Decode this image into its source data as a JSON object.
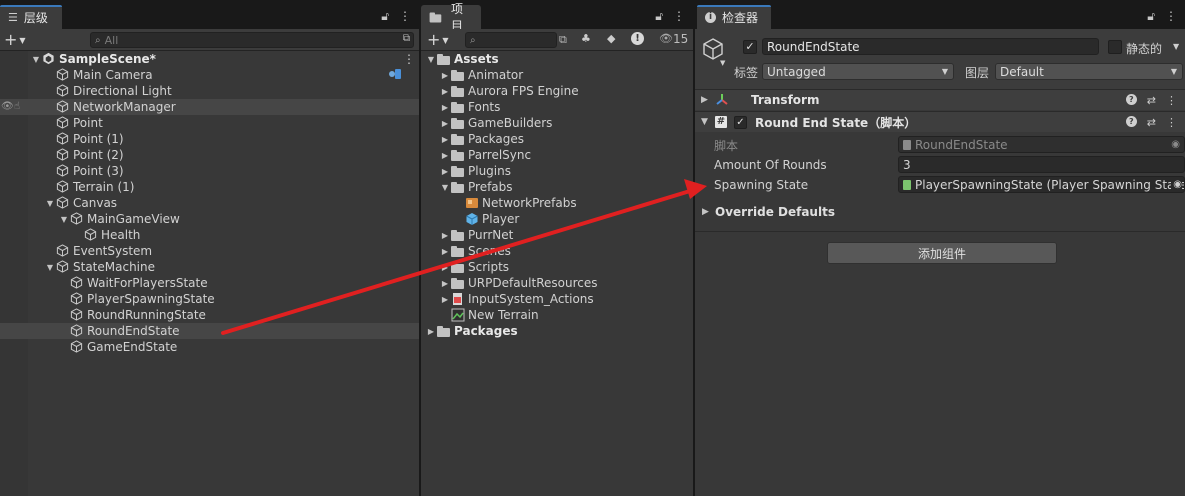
{
  "hierarchy": {
    "tab_label": "层级",
    "search_placeholder": "All",
    "rows": [
      {
        "label": "SampleScene*",
        "depth": 0,
        "arrow": "open",
        "icon": "unity-scene-icon",
        "bold": true,
        "highlighted": false
      },
      {
        "label": "Main Camera",
        "depth": 1,
        "arrow": "",
        "icon": "cube-icon",
        "bold": false,
        "highlighted": false
      },
      {
        "label": "Directional Light",
        "depth": 1,
        "arrow": "",
        "icon": "cube-icon",
        "bold": false,
        "highlighted": false
      },
      {
        "label": "NetworkManager",
        "depth": 1,
        "arrow": "",
        "icon": "cube-icon",
        "bold": false,
        "highlighted": true
      },
      {
        "label": "Point",
        "depth": 1,
        "arrow": "",
        "icon": "cube-icon",
        "bold": false,
        "highlighted": false
      },
      {
        "label": "Point (1)",
        "depth": 1,
        "arrow": "",
        "icon": "cube-icon",
        "bold": false,
        "highlighted": false
      },
      {
        "label": "Point (2)",
        "depth": 1,
        "arrow": "",
        "icon": "cube-icon",
        "bold": false,
        "highlighted": false
      },
      {
        "label": "Point (3)",
        "depth": 1,
        "arrow": "",
        "icon": "cube-icon",
        "bold": false,
        "highlighted": false
      },
      {
        "label": "Terrain (1)",
        "depth": 1,
        "arrow": "",
        "icon": "cube-icon",
        "bold": false,
        "highlighted": false
      },
      {
        "label": "Canvas",
        "depth": 1,
        "arrow": "open",
        "icon": "cube-icon",
        "bold": false,
        "highlighted": false
      },
      {
        "label": "MainGameView",
        "depth": 2,
        "arrow": "open",
        "icon": "cube-icon",
        "bold": false,
        "highlighted": false
      },
      {
        "label": "Health",
        "depth": 3,
        "arrow": "",
        "icon": "cube-icon",
        "bold": false,
        "highlighted": false
      },
      {
        "label": "EventSystem",
        "depth": 1,
        "arrow": "",
        "icon": "cube-icon",
        "bold": false,
        "highlighted": false
      },
      {
        "label": "StateMachine",
        "depth": 1,
        "arrow": "open",
        "icon": "cube-icon",
        "bold": false,
        "highlighted": false
      },
      {
        "label": "WaitForPlayersState",
        "depth": 2,
        "arrow": "",
        "icon": "cube-icon",
        "bold": false,
        "highlighted": false
      },
      {
        "label": "PlayerSpawningState",
        "depth": 2,
        "arrow": "",
        "icon": "cube-icon",
        "bold": false,
        "highlighted": false
      },
      {
        "label": "RoundRunningState",
        "depth": 2,
        "arrow": "",
        "icon": "cube-icon",
        "bold": false,
        "highlighted": false
      },
      {
        "label": "RoundEndState",
        "depth": 2,
        "arrow": "",
        "icon": "cube-icon",
        "bold": false,
        "highlighted": true
      },
      {
        "label": "GameEndState",
        "depth": 2,
        "arrow": "",
        "icon": "cube-icon",
        "bold": false,
        "highlighted": false
      }
    ]
  },
  "project": {
    "tab_label": "项目",
    "hidden_count": "15",
    "rows": [
      {
        "label": "Assets",
        "depth": 0,
        "arrow": "open",
        "icon": "folder-icon",
        "bold": true
      },
      {
        "label": "Animator",
        "depth": 1,
        "arrow": "closed",
        "icon": "folder-icon",
        "bold": false
      },
      {
        "label": "Aurora FPS Engine",
        "depth": 1,
        "arrow": "closed",
        "icon": "folder-icon",
        "bold": false
      },
      {
        "label": "Fonts",
        "depth": 1,
        "arrow": "closed",
        "icon": "folder-icon",
        "bold": false
      },
      {
        "label": "GameBuilders",
        "depth": 1,
        "arrow": "closed",
        "icon": "folder-icon",
        "bold": false
      },
      {
        "label": "Packages",
        "depth": 1,
        "arrow": "closed",
        "icon": "folder-icon",
        "bold": false
      },
      {
        "label": "ParrelSync",
        "depth": 1,
        "arrow": "closed",
        "icon": "folder-icon",
        "bold": false
      },
      {
        "label": "Plugins",
        "depth": 1,
        "arrow": "closed",
        "icon": "folder-icon",
        "bold": false
      },
      {
        "label": "Prefabs",
        "depth": 1,
        "arrow": "open",
        "icon": "folder-icon",
        "bold": false
      },
      {
        "label": "NetworkPrefabs",
        "depth": 2,
        "arrow": "",
        "icon": "network-prefabs-icon",
        "bold": false
      },
      {
        "label": "Player",
        "depth": 2,
        "arrow": "",
        "icon": "prefab-icon",
        "bold": false
      },
      {
        "label": "PurrNet",
        "depth": 1,
        "arrow": "closed",
        "icon": "folder-icon",
        "bold": false
      },
      {
        "label": "Scenes",
        "depth": 1,
        "arrow": "closed",
        "icon": "folder-icon",
        "bold": false
      },
      {
        "label": "Scripts",
        "depth": 1,
        "arrow": "closed",
        "icon": "folder-icon",
        "bold": false
      },
      {
        "label": "URPDefaultResources",
        "depth": 1,
        "arrow": "closed",
        "icon": "folder-icon",
        "bold": false
      },
      {
        "label": "InputSystem_Actions",
        "depth": 1,
        "arrow": "closed",
        "icon": "input-actions-icon",
        "bold": false
      },
      {
        "label": "New Terrain",
        "depth": 1,
        "arrow": "",
        "icon": "terrain-icon",
        "bold": false
      },
      {
        "label": "Packages",
        "depth": 0,
        "arrow": "closed",
        "icon": "folder-icon",
        "bold": true
      }
    ]
  },
  "inspector": {
    "tab_label": "检查器",
    "object_name": "RoundEndState",
    "static_label": "静态的",
    "tag_label": "标签",
    "tag_value": "Untagged",
    "layer_label": "图层",
    "layer_value": "Default",
    "transform_title": "Transform",
    "component_title": "Round End State（脚本）",
    "props": {
      "script_label": "脚本",
      "script_value": "RoundEndState",
      "rounds_label": "Amount Of Rounds",
      "rounds_value": "3",
      "spawning_label": "Spawning State",
      "spawning_value": "PlayerSpawningState (Player Spawning State"
    },
    "override_label": "Override Defaults",
    "add_component_label": "添加组件"
  },
  "colors": {
    "annotation_arrow": "#e02020",
    "tab_accent": "#3a79bb"
  }
}
